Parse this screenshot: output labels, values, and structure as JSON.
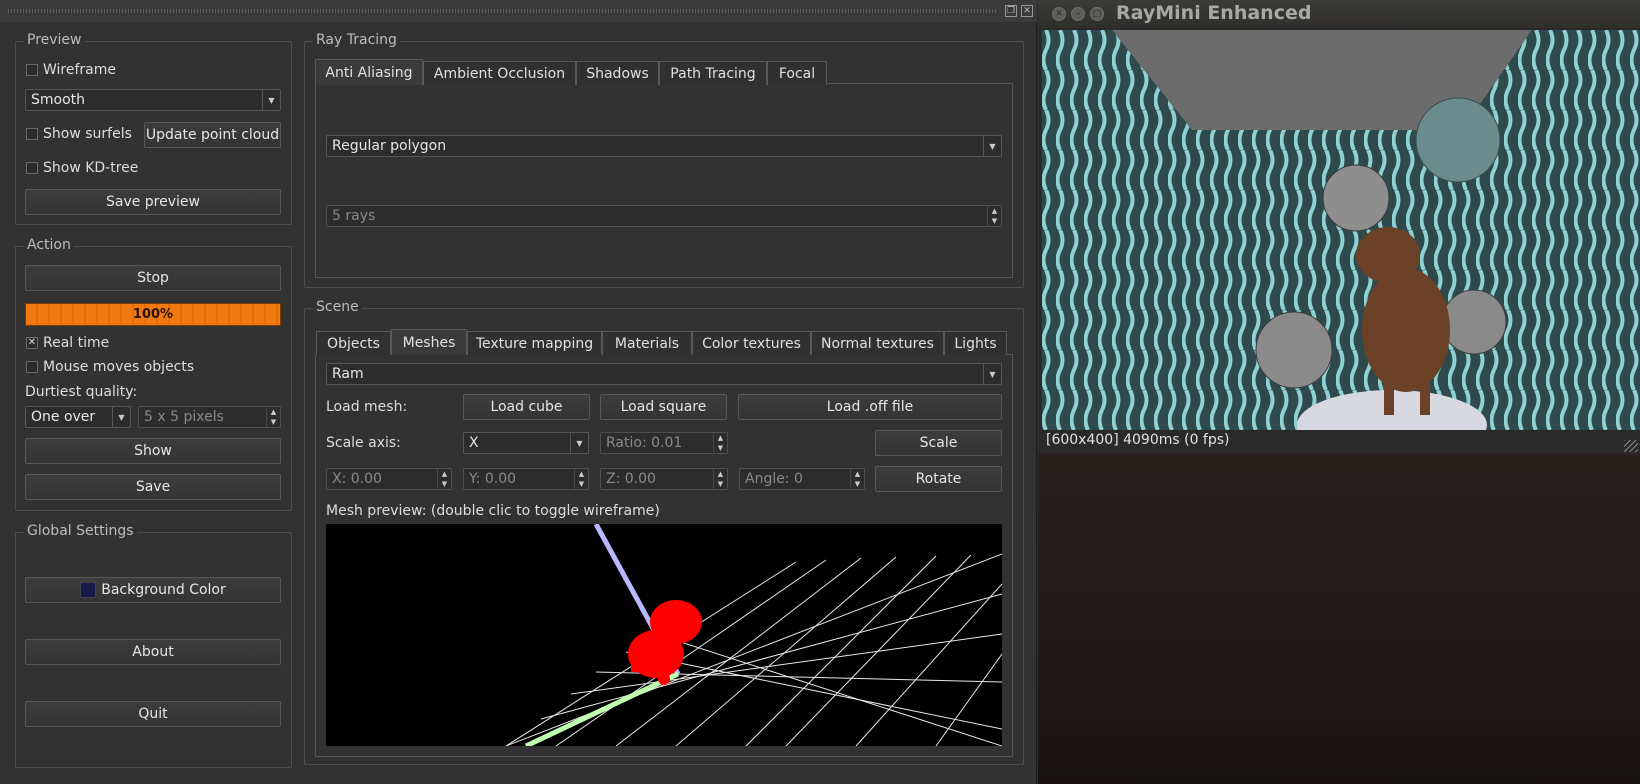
{
  "preview": {
    "title": "Preview",
    "wireframe_label": "Wireframe",
    "shading_mode": "Smooth",
    "show_surfels_label": "Show surfels",
    "update_point_cloud_label": "Update point cloud",
    "show_kdtree_label": "Show KD-tree",
    "save_preview_label": "Save preview"
  },
  "action": {
    "title": "Action",
    "stop_label": "Stop",
    "progress": 100,
    "progress_text": "100%",
    "real_time_label": "Real time",
    "real_time_checked": true,
    "mouse_moves_label": "Mouse moves objects",
    "durtiest_quality_label": "Durtiest quality:",
    "quality_mode": "One over",
    "quality_value": "5 x 5 pixels",
    "show_label": "Show",
    "save_label": "Save"
  },
  "global": {
    "title": "Global Settings",
    "background_color_label": "Background Color",
    "background_color": "#1a1a4a",
    "about_label": "About",
    "quit_label": "Quit"
  },
  "ray_tracing": {
    "title": "Ray Tracing",
    "tabs": [
      "Anti Aliasing",
      "Ambient Occlusion",
      "Shadows",
      "Path Tracing",
      "Focal"
    ],
    "active_tab": "Anti Aliasing",
    "aa_method": "Regular polygon",
    "aa_rays": "5 rays"
  },
  "scene": {
    "title": "Scene",
    "tabs": [
      "Objects",
      "Meshes",
      "Texture mapping",
      "Materials",
      "Color textures",
      "Normal textures",
      "Lights"
    ],
    "active_tab": "Meshes",
    "selected_mesh": "Ram",
    "load_mesh_label": "Load mesh:",
    "load_cube_label": "Load cube",
    "load_square_label": "Load square",
    "load_off_label": "Load .off file",
    "scale_axis_label": "Scale axis:",
    "scale_axis_value": "X",
    "ratio_value": "Ratio: 0.01",
    "scale_label": "Scale",
    "x_value": "X: 0.00",
    "y_value": "Y: 0.00",
    "z_value": "Z: 0.00",
    "angle_value": "Angle: 0",
    "rotate_label": "Rotate",
    "mesh_preview_label": "Mesh preview: (double clic to toggle wireframe)"
  },
  "render_window": {
    "title": "RayMini Enhanced",
    "status": "[600x400] 4090ms (0 fps)"
  },
  "colors": {
    "accent": "#f07a10",
    "panel": "#323232",
    "render_wall": "#5fa6a8"
  }
}
